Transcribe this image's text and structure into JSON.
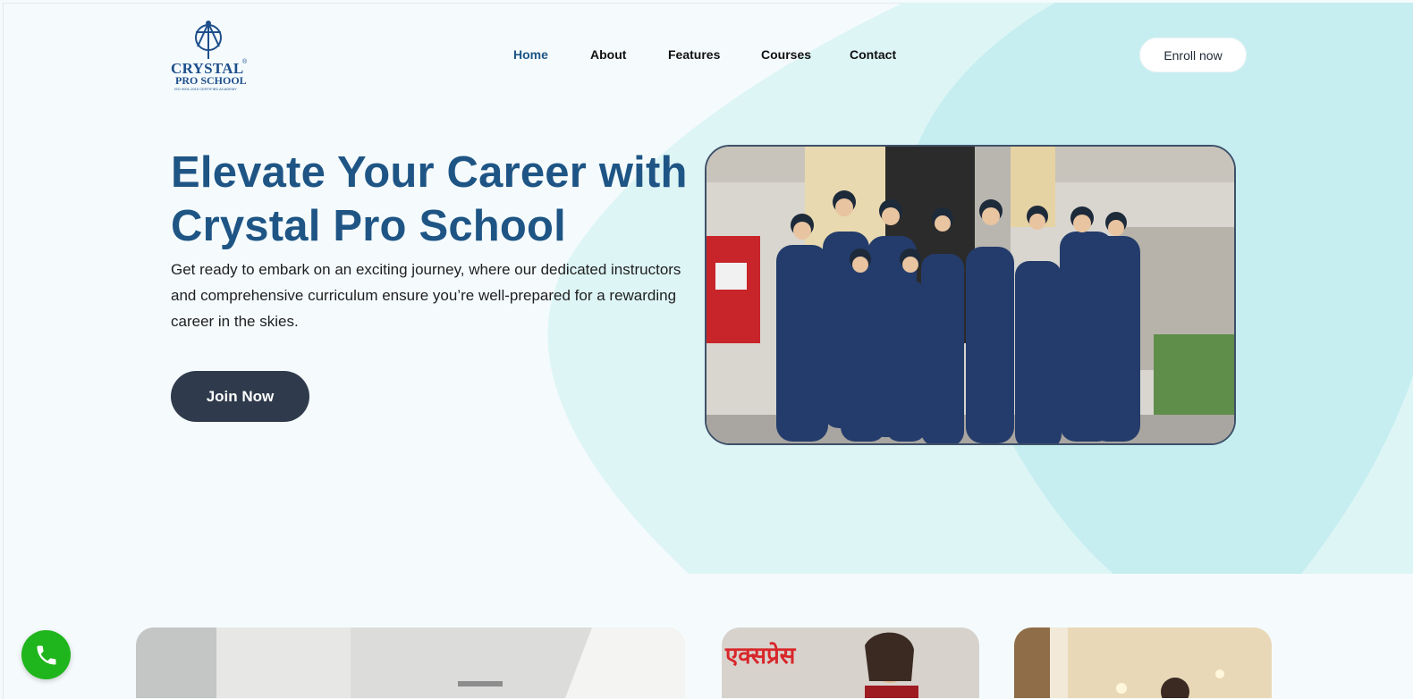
{
  "brand": {
    "name": "CRYSTAL",
    "sub": "PRO SCHOOL",
    "tagline": "ISO 9001-2015 CERTIFIED ACADEMY",
    "registered": "®"
  },
  "nav": {
    "items": [
      {
        "label": "Home",
        "active": true
      },
      {
        "label": "About",
        "active": false
      },
      {
        "label": "Features",
        "active": false
      },
      {
        "label": "Courses",
        "active": false
      },
      {
        "label": "Contact",
        "active": false
      }
    ],
    "cta": "Enroll now"
  },
  "hero": {
    "title_line1": "Elevate Your Career with",
    "title_line2": "Crystal Pro School",
    "description": "Get ready to embark on an exciting journey, where our dedicated instructors and comprehensive curriculum ensure you’re well-prepared for a rewarding career in the skies.",
    "button": "Join Now",
    "photo_icon": "group-of-students-photo"
  },
  "gallery": {
    "card2_sign": "एक्सप्रेस"
  },
  "floating": {
    "icon": "phone-icon"
  },
  "colors": {
    "accent": "#1e5585",
    "active_nav": "#1e5585",
    "button_dark": "#2f3b4c",
    "blob": "#c9eef0",
    "call_green": "#1fb51c"
  }
}
